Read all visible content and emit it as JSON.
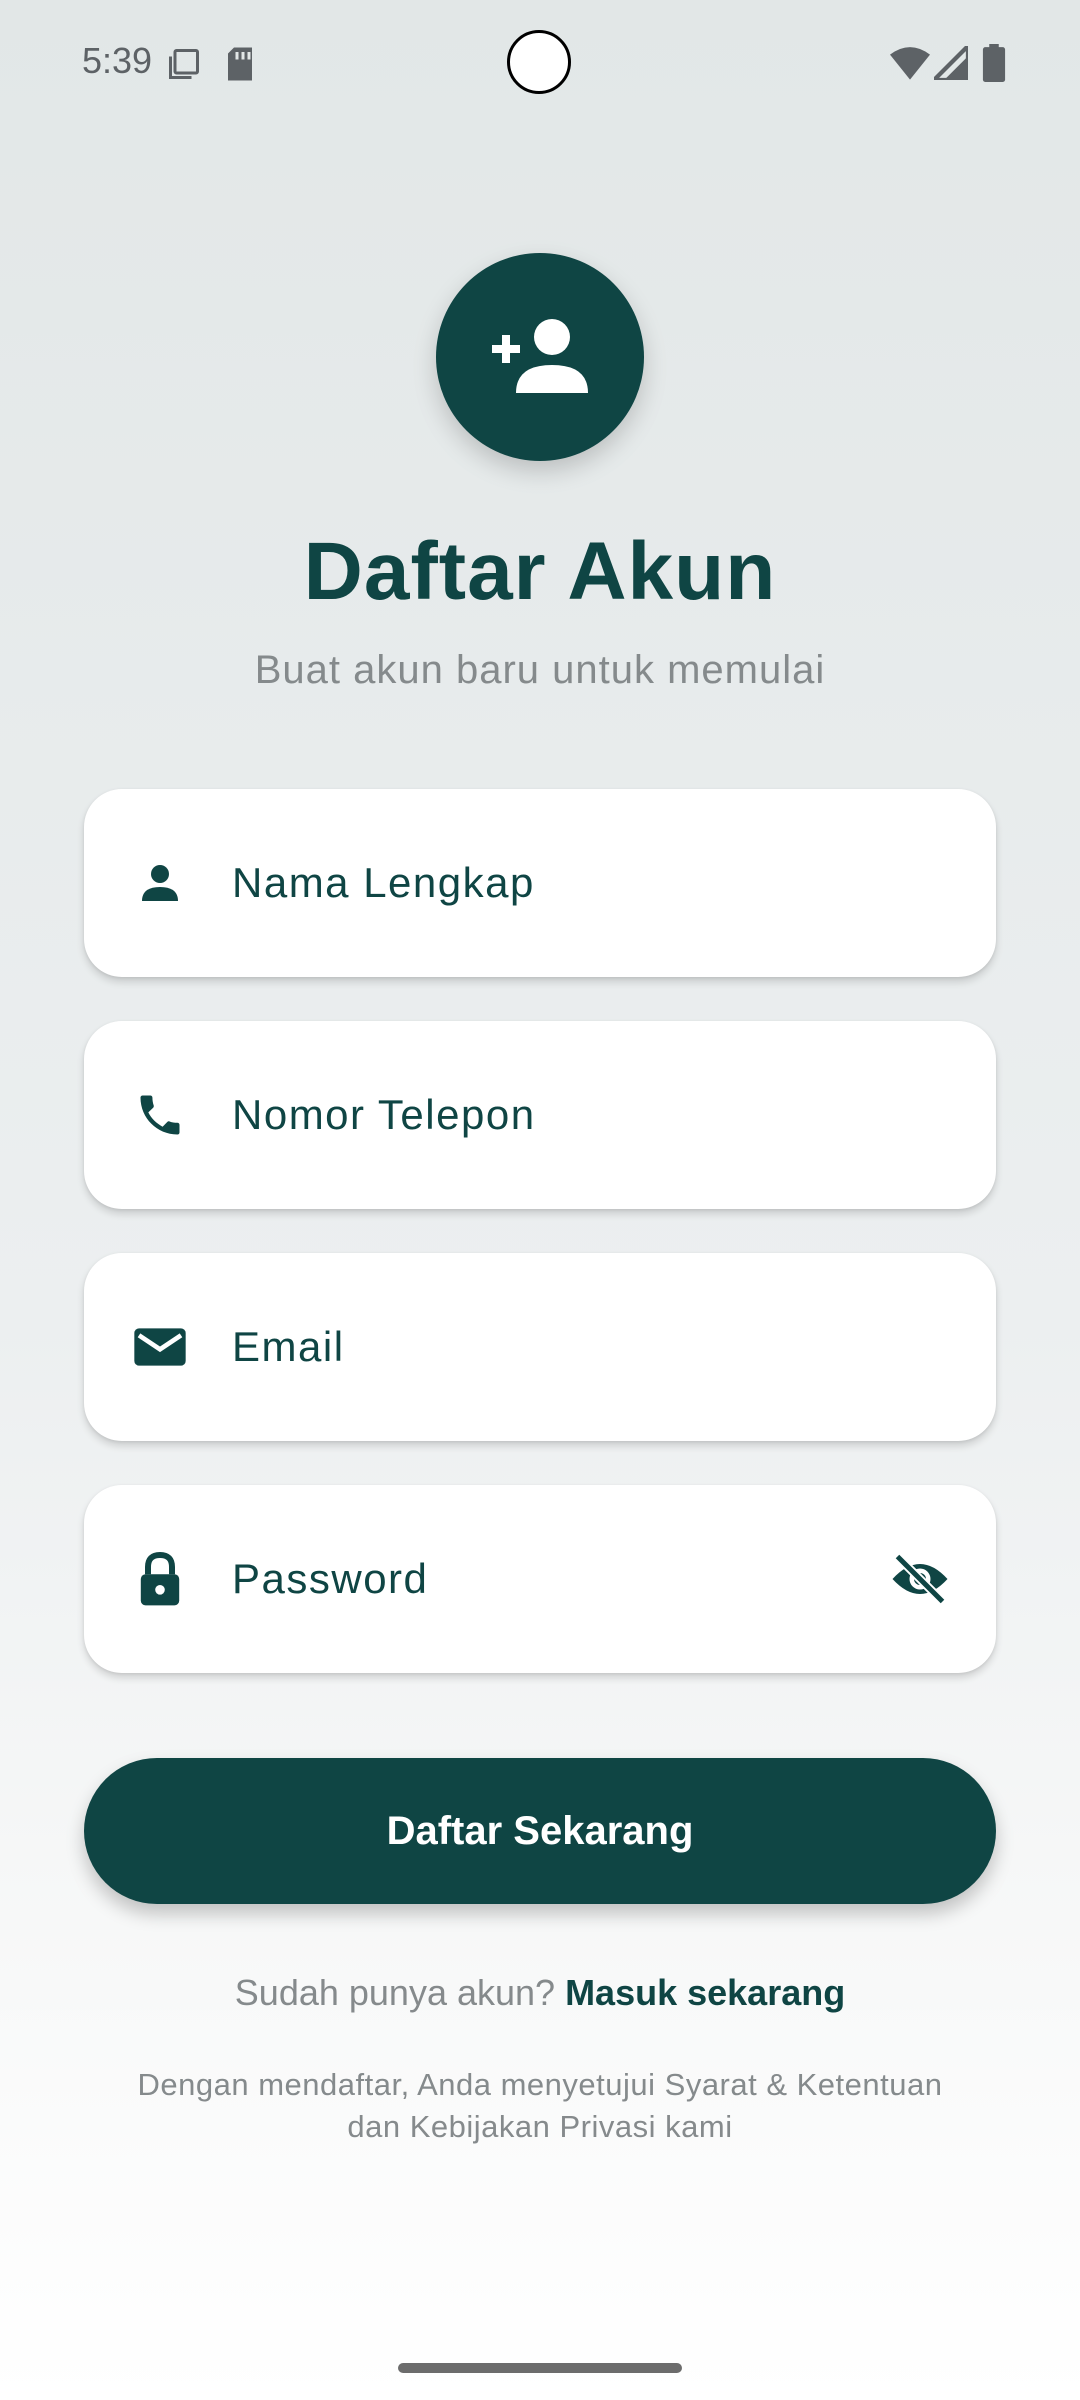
{
  "status_bar": {
    "time": "5:39",
    "icons": [
      "screenshot-icon",
      "sd-card-icon",
      "wifi-icon",
      "cellular-signal-icon",
      "battery-icon"
    ]
  },
  "header": {
    "avatar_icon": "person-add-icon",
    "title": "Daftar Akun",
    "subtitle": "Buat akun baru untuk memulai"
  },
  "form": {
    "name": {
      "icon": "person-icon",
      "placeholder": "Nama Lengkap",
      "value": ""
    },
    "phone": {
      "icon": "phone-icon",
      "placeholder": "Nomor Telepon",
      "value": ""
    },
    "email": {
      "icon": "mail-icon",
      "placeholder": "Email",
      "value": ""
    },
    "password": {
      "icon": "lock-icon",
      "placeholder": "Password",
      "value": "",
      "toggle_icon": "visibility-off-icon"
    }
  },
  "submit_label": "Daftar Sekarang",
  "login_prompt": {
    "text": "Sudah punya akun?",
    "link": "Masuk sekarang"
  },
  "terms": {
    "line1": "Dengan mendaftar, Anda menyetujui Syarat & Ketentuan",
    "line2": "dan Kebijakan Privasi kami"
  },
  "colors": {
    "primary": "#0f4544",
    "muted_text": "#858a8c",
    "background_top": "#e2e7e7",
    "background_bottom": "#ffffff",
    "field_background": "#ffffff"
  }
}
